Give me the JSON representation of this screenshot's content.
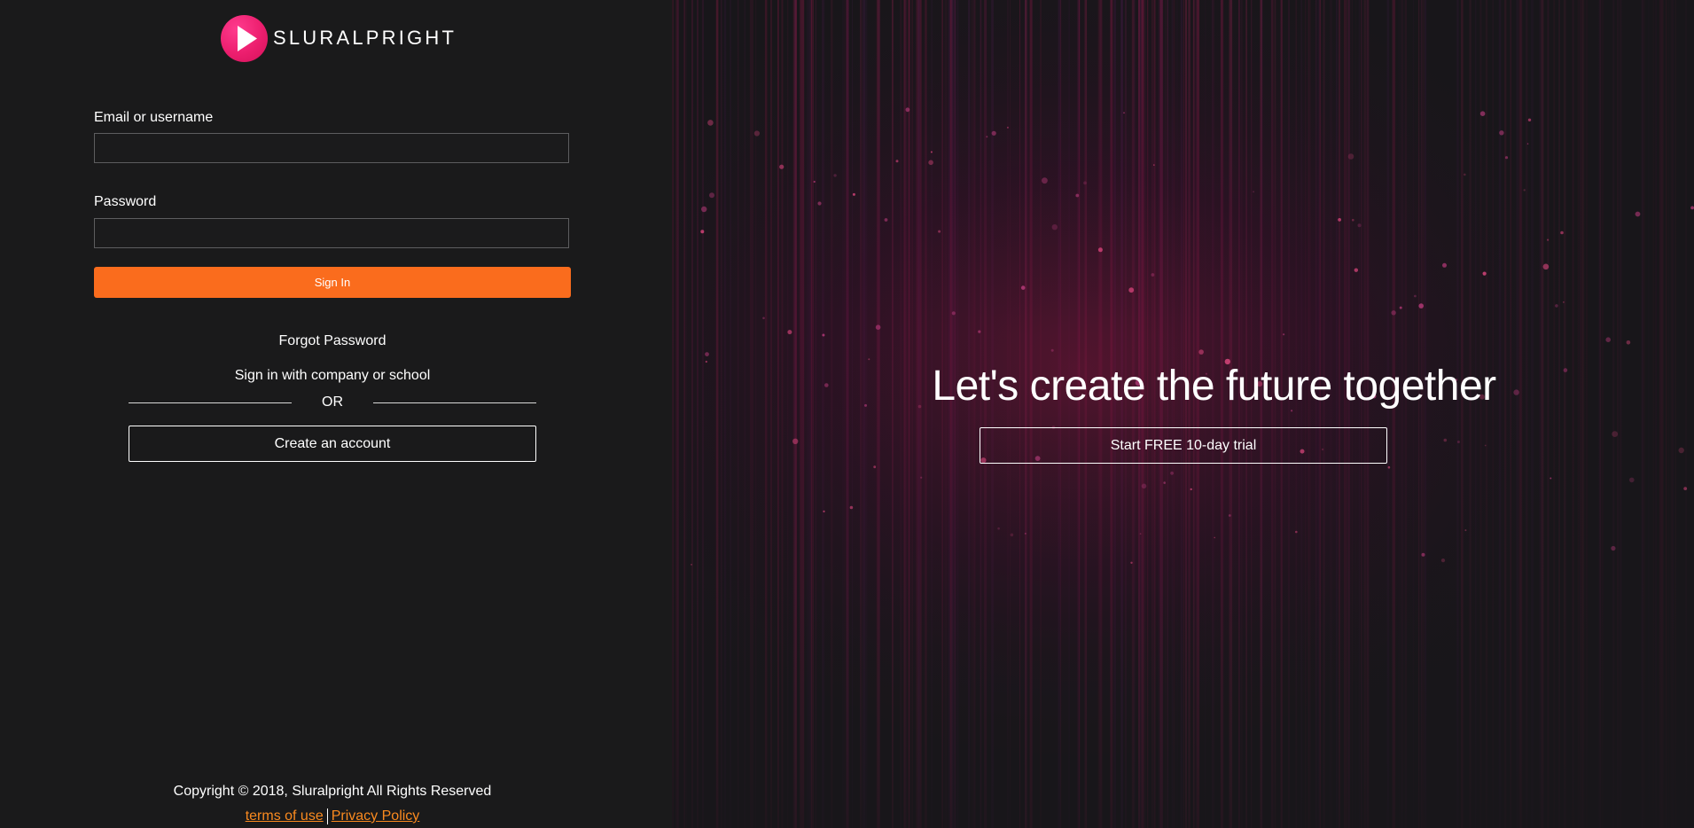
{
  "brand": {
    "name": "SLURALPRIGHT",
    "logo_icon": "play-logo-icon",
    "accent_color": "#ec1e6e"
  },
  "login_form": {
    "email_label": "Email or username",
    "email_value": "",
    "email_placeholder": "",
    "password_label": "Password",
    "password_value": "",
    "password_placeholder": "",
    "signin_label": "Sign In",
    "signin_color": "#fa6c1d"
  },
  "links": {
    "forgot_password": "Forgot Password",
    "company_signin": "Sign in with company or school",
    "divider_text": "OR",
    "create_account": "Create an account"
  },
  "footer": {
    "copyright": "Copyright © 2018, Sluralpright All Rights Reserved",
    "terms_label": "terms of use",
    "privacy_label": "Privacy Policy",
    "link_color": "#fa8a1f"
  },
  "hero": {
    "title": "Let's create the future together",
    "cta_label": "Start FREE 10-day trial"
  }
}
